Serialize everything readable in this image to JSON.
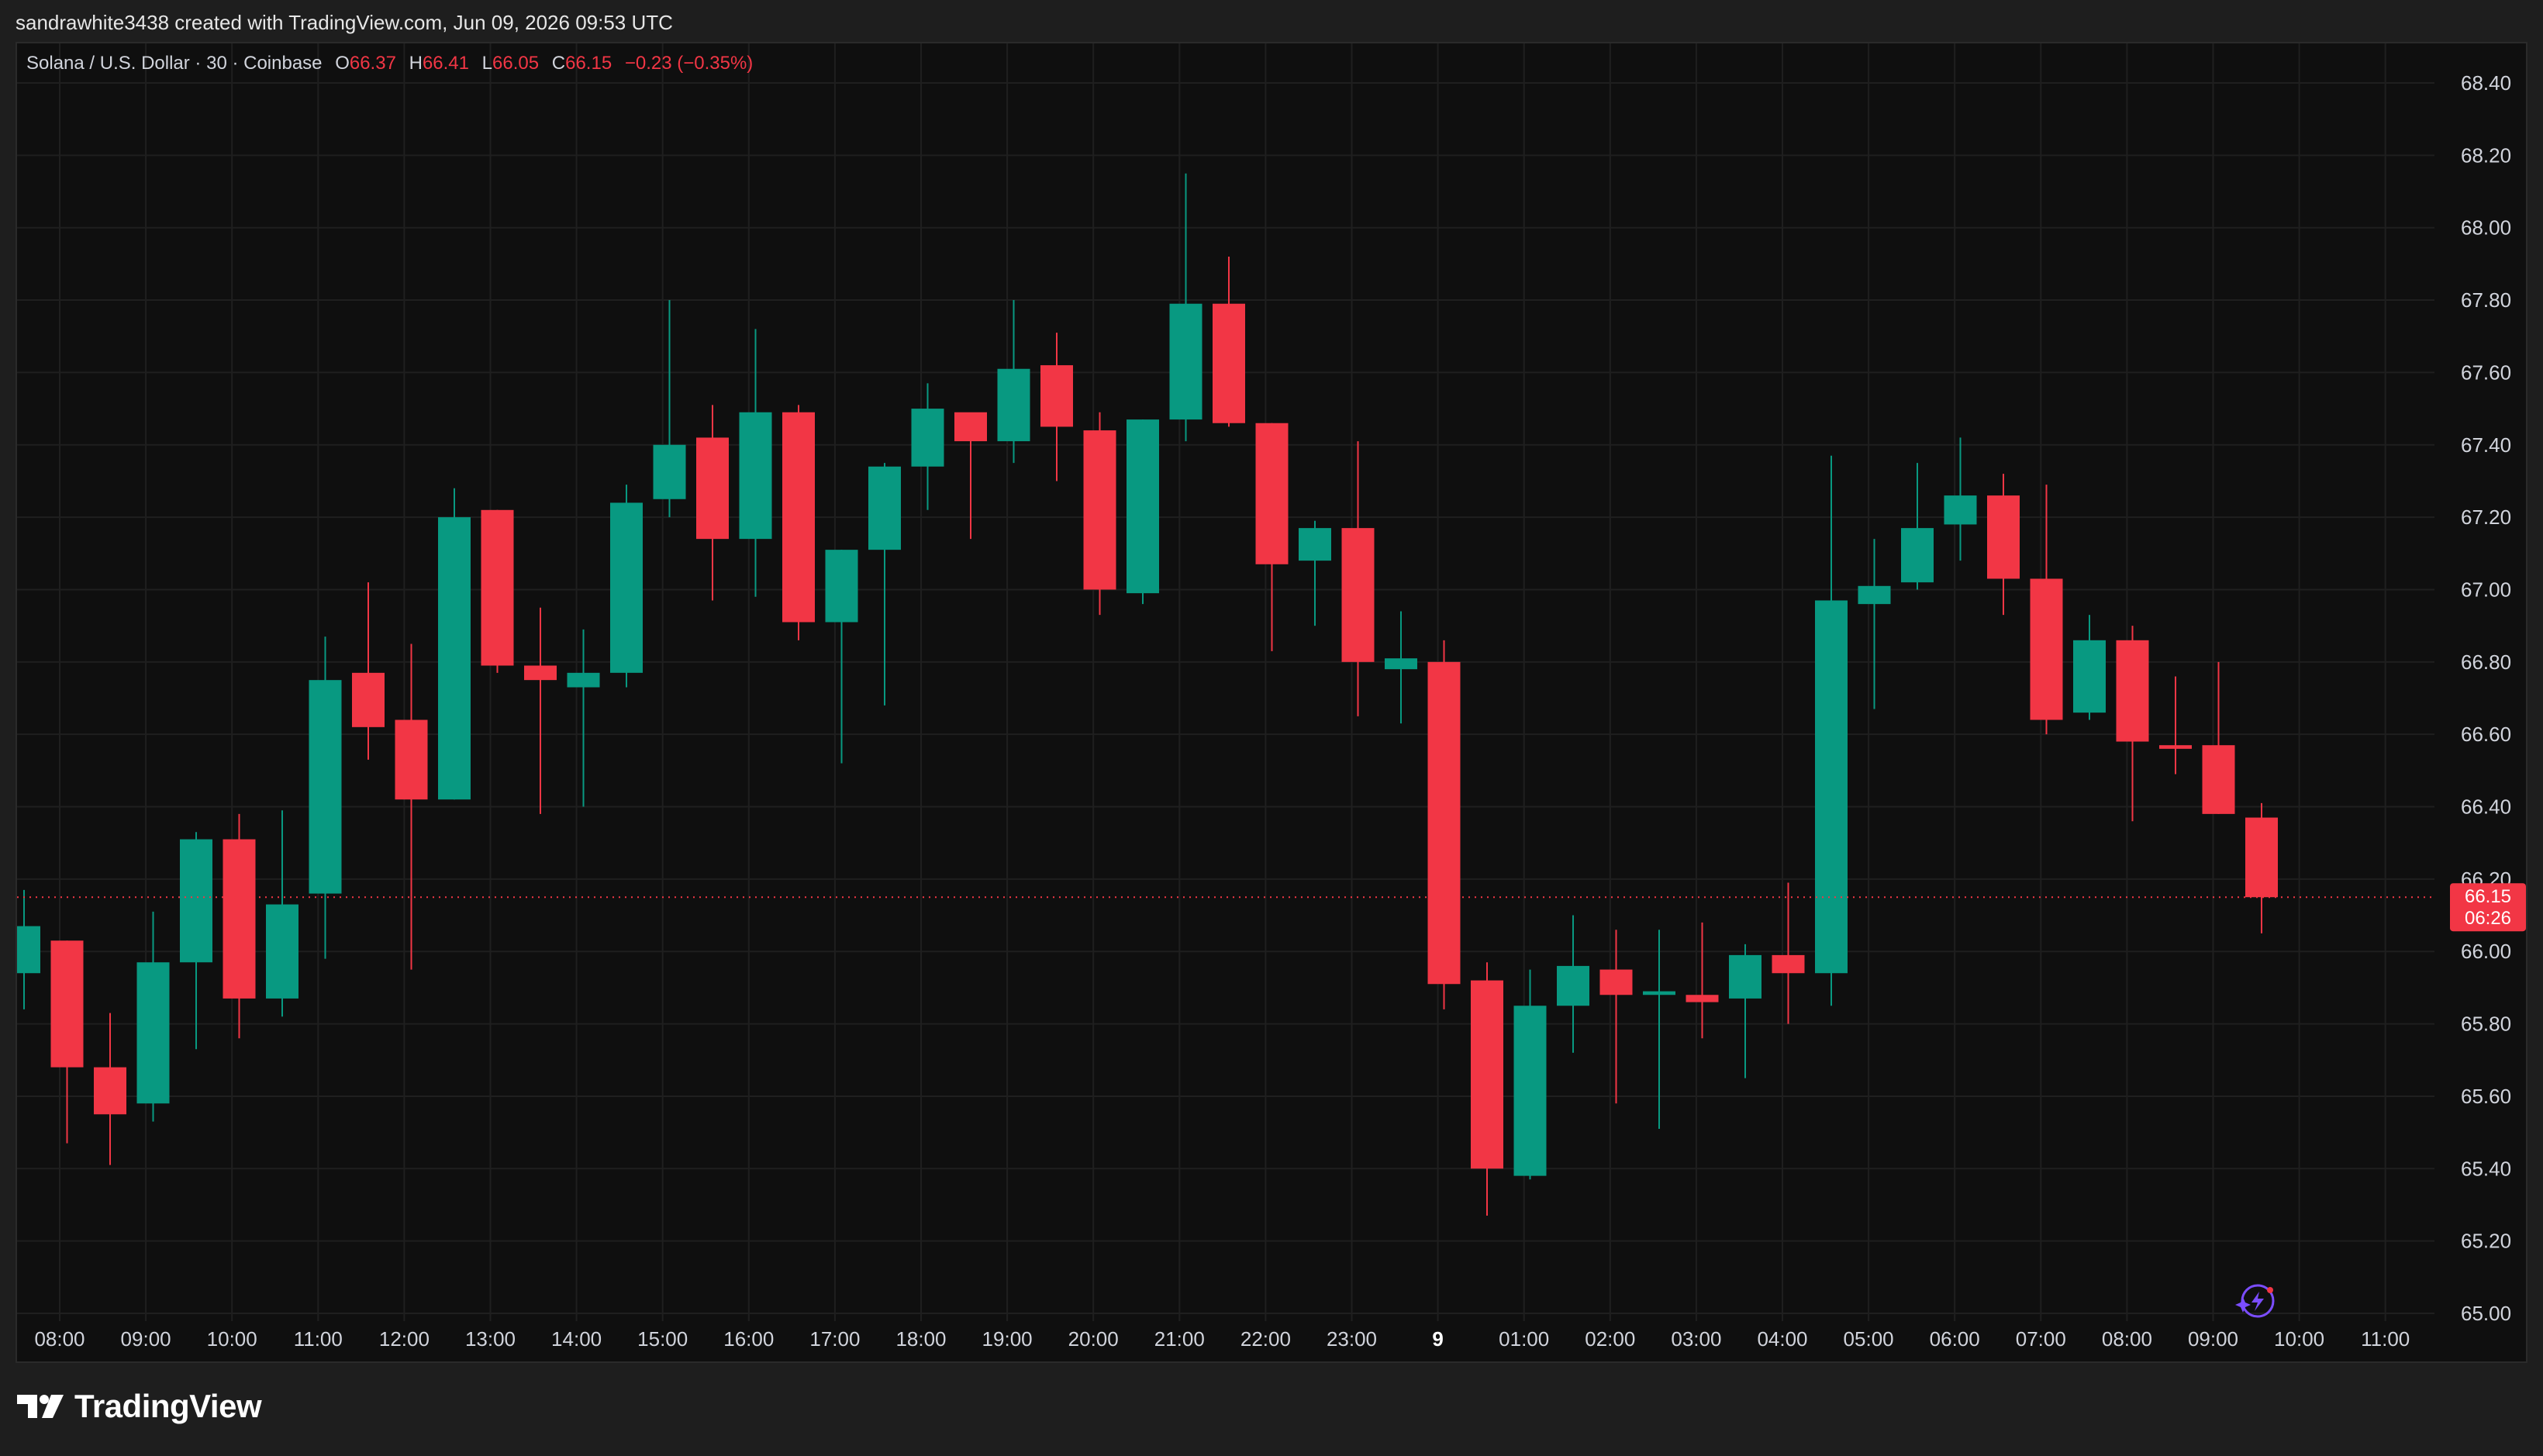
{
  "caption": "sandrawhite3438 created with TradingView.com, Jun 09, 2026 09:53 UTC",
  "legend": {
    "symbol": "Solana / U.S. Dollar · 30 · Coinbase",
    "o_label": "O",
    "o_value": "66.37",
    "h_label": "H",
    "h_value": "66.41",
    "l_label": "L",
    "l_value": "66.05",
    "c_label": "C",
    "c_value": "66.15",
    "change": "−0.23 (−0.35%)"
  },
  "price_tag": {
    "price": "66.15",
    "countdown": "06:26"
  },
  "brand": {
    "name": "TradingView"
  },
  "colors": {
    "up": "#089981",
    "down": "#f23645",
    "background": "#0f0f0f",
    "grid": "#1f1f1f",
    "text": "#d1d4dc",
    "bolt_icon": "#7b4dff"
  },
  "chart_data": {
    "type": "candlestick",
    "interval": "30",
    "ylim": [
      65.0,
      68.4
    ],
    "y_ticks": [
      "65.00",
      "65.20",
      "65.40",
      "65.60",
      "65.80",
      "66.00",
      "66.20",
      "66.40",
      "66.60",
      "66.80",
      "67.00",
      "67.20",
      "67.40",
      "67.60",
      "67.80",
      "68.00",
      "68.20",
      "68.40"
    ],
    "x_ticks": [
      "08:00",
      "09:00",
      "10:00",
      "11:00",
      "12:00",
      "13:00",
      "14:00",
      "15:00",
      "16:00",
      "17:00",
      "18:00",
      "19:00",
      "20:00",
      "21:00",
      "22:00",
      "23:00",
      "9",
      "01:00",
      "02:00",
      "03:00",
      "04:00",
      "05:00",
      "06:00",
      "07:00",
      "08:00",
      "09:00",
      "10:00",
      "11:00"
    ],
    "bold_x_tick": "9",
    "last_price": 66.15,
    "grid": true,
    "candles": [
      {
        "o": 65.94,
        "h": 66.17,
        "l": 65.84,
        "c": 66.07
      },
      {
        "o": 66.03,
        "h": 66.03,
        "l": 65.47,
        "c": 65.68
      },
      {
        "o": 65.68,
        "h": 65.83,
        "l": 65.41,
        "c": 65.55
      },
      {
        "o": 65.58,
        "h": 66.11,
        "l": 65.53,
        "c": 65.97
      },
      {
        "o": 65.97,
        "h": 66.33,
        "l": 65.73,
        "c": 66.31
      },
      {
        "o": 66.31,
        "h": 66.38,
        "l": 65.76,
        "c": 65.87
      },
      {
        "o": 65.87,
        "h": 66.39,
        "l": 65.82,
        "c": 66.13
      },
      {
        "o": 66.16,
        "h": 66.87,
        "l": 65.98,
        "c": 66.75
      },
      {
        "o": 66.77,
        "h": 67.02,
        "l": 66.53,
        "c": 66.62
      },
      {
        "o": 66.64,
        "h": 66.85,
        "l": 65.95,
        "c": 66.42
      },
      {
        "o": 66.42,
        "h": 67.28,
        "l": 66.42,
        "c": 67.2
      },
      {
        "o": 67.22,
        "h": 67.22,
        "l": 66.77,
        "c": 66.79
      },
      {
        "o": 66.79,
        "h": 66.95,
        "l": 66.38,
        "c": 66.75
      },
      {
        "o": 66.73,
        "h": 66.89,
        "l": 66.4,
        "c": 66.77
      },
      {
        "o": 66.77,
        "h": 67.29,
        "l": 66.73,
        "c": 67.24
      },
      {
        "o": 67.25,
        "h": 67.8,
        "l": 67.2,
        "c": 67.4
      },
      {
        "o": 67.42,
        "h": 67.51,
        "l": 66.97,
        "c": 67.14
      },
      {
        "o": 67.14,
        "h": 67.72,
        "l": 66.98,
        "c": 67.49
      },
      {
        "o": 67.49,
        "h": 67.51,
        "l": 66.86,
        "c": 66.91
      },
      {
        "o": 66.91,
        "h": 67.11,
        "l": 66.52,
        "c": 67.11
      },
      {
        "o": 67.11,
        "h": 67.35,
        "l": 66.68,
        "c": 67.34
      },
      {
        "o": 67.34,
        "h": 67.57,
        "l": 67.22,
        "c": 67.5
      },
      {
        "o": 67.49,
        "h": 67.46,
        "l": 67.14,
        "c": 67.41
      },
      {
        "o": 67.41,
        "h": 67.8,
        "l": 67.35,
        "c": 67.61
      },
      {
        "o": 67.62,
        "h": 67.71,
        "l": 67.3,
        "c": 67.45
      },
      {
        "o": 67.44,
        "h": 67.49,
        "l": 66.93,
        "c": 67.0
      },
      {
        "o": 66.99,
        "h": 67.47,
        "l": 66.96,
        "c": 67.47
      },
      {
        "o": 67.47,
        "h": 68.15,
        "l": 67.41,
        "c": 67.79
      },
      {
        "o": 67.79,
        "h": 67.92,
        "l": 67.45,
        "c": 67.46
      },
      {
        "o": 67.46,
        "h": 67.46,
        "l": 66.83,
        "c": 67.07
      },
      {
        "o": 67.08,
        "h": 67.19,
        "l": 66.9,
        "c": 67.17
      },
      {
        "o": 67.17,
        "h": 67.41,
        "l": 66.65,
        "c": 66.8
      },
      {
        "o": 66.78,
        "h": 66.94,
        "l": 66.63,
        "c": 66.81
      },
      {
        "o": 66.8,
        "h": 66.86,
        "l": 65.84,
        "c": 65.91
      },
      {
        "o": 65.92,
        "h": 65.97,
        "l": 65.27,
        "c": 65.4
      },
      {
        "o": 65.38,
        "h": 65.95,
        "l": 65.37,
        "c": 65.85
      },
      {
        "o": 65.85,
        "h": 66.1,
        "l": 65.72,
        "c": 65.96
      },
      {
        "o": 65.95,
        "h": 66.06,
        "l": 65.58,
        "c": 65.88
      },
      {
        "o": 65.88,
        "h": 66.06,
        "l": 65.51,
        "c": 65.89
      },
      {
        "o": 65.88,
        "h": 66.08,
        "l": 65.76,
        "c": 65.86
      },
      {
        "o": 65.87,
        "h": 66.02,
        "l": 65.65,
        "c": 65.99
      },
      {
        "o": 65.99,
        "h": 66.19,
        "l": 65.8,
        "c": 65.94
      },
      {
        "o": 65.94,
        "h": 67.37,
        "l": 65.85,
        "c": 66.97
      },
      {
        "o": 66.96,
        "h": 67.14,
        "l": 66.67,
        "c": 67.01
      },
      {
        "o": 67.02,
        "h": 67.35,
        "l": 67.0,
        "c": 67.17
      },
      {
        "o": 67.18,
        "h": 67.42,
        "l": 67.08,
        "c": 67.26
      },
      {
        "o": 67.26,
        "h": 67.32,
        "l": 66.93,
        "c": 67.03
      },
      {
        "o": 67.03,
        "h": 67.29,
        "l": 66.6,
        "c": 66.64
      },
      {
        "o": 66.66,
        "h": 66.93,
        "l": 66.64,
        "c": 66.86
      },
      {
        "o": 66.86,
        "h": 66.9,
        "l": 66.36,
        "c": 66.58
      },
      {
        "o": 66.57,
        "h": 66.76,
        "l": 66.49,
        "c": 66.56
      },
      {
        "o": 66.57,
        "h": 66.8,
        "l": 66.38,
        "c": 66.38
      },
      {
        "o": 66.37,
        "h": 66.41,
        "l": 66.05,
        "c": 66.15
      }
    ]
  }
}
